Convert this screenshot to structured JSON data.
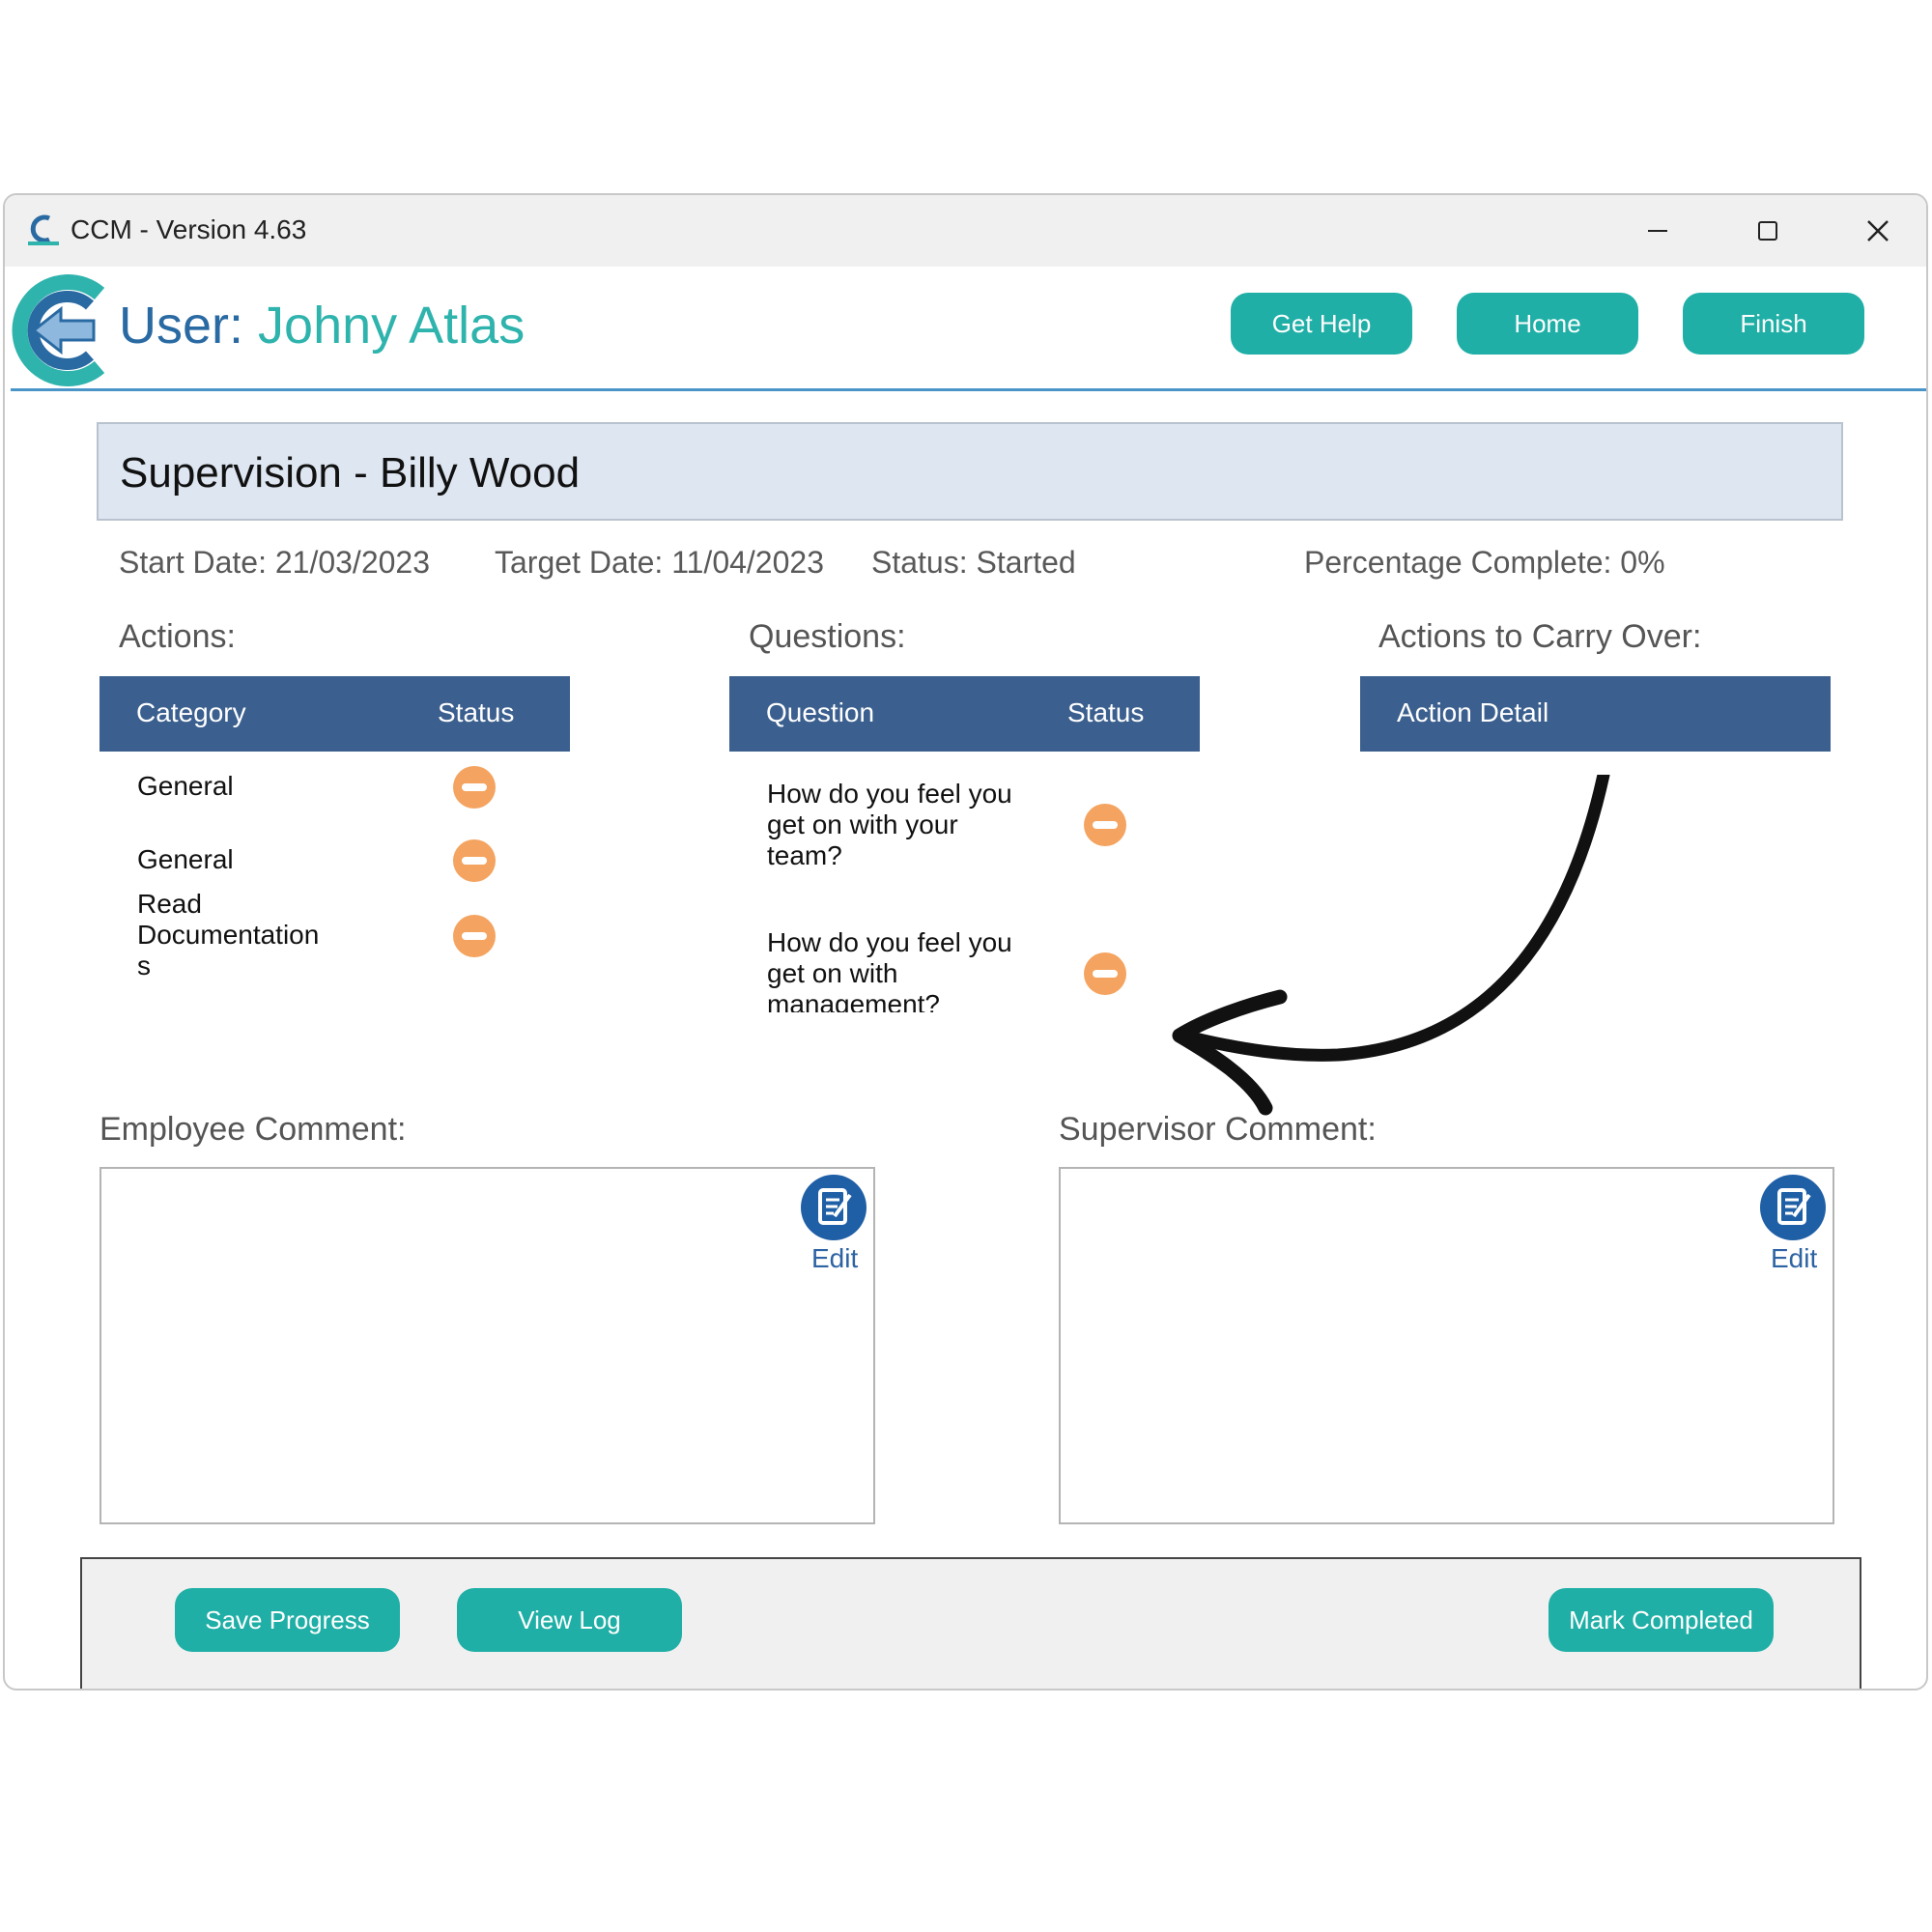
{
  "window": {
    "title": "CCM - Version 4.63",
    "controls": [
      "minimize-icon",
      "maximize-icon",
      "close-icon"
    ]
  },
  "header": {
    "user_label": "User:",
    "user_name": "Johny Atlas",
    "buttons": {
      "help": "Get Help",
      "home": "Home",
      "finish": "Finish"
    }
  },
  "supervision": {
    "title": "Supervision - Billy Wood",
    "start_date": "Start Date: 21/03/2023",
    "target_date": "Target Date: 11/04/2023",
    "status": "Status: Started",
    "percentage": "Percentage Complete: 0%"
  },
  "actions": {
    "label": "Actions:",
    "columns": [
      "Category",
      "Status"
    ],
    "rows": [
      {
        "category": "General",
        "status_icon": "minus-circle-icon"
      },
      {
        "category": "General",
        "status_icon": "minus-circle-icon"
      },
      {
        "category_lines": [
          "Read",
          "Documentation",
          "s"
        ],
        "status_icon": "minus-circle-icon"
      }
    ]
  },
  "questions": {
    "label": "Questions:",
    "columns": [
      "Question",
      "Status"
    ],
    "rows": [
      {
        "lines": [
          "How do you feel you",
          "get on with your",
          "team?"
        ],
        "status_icon": "minus-circle-icon"
      },
      {
        "lines": [
          "How do you feel you",
          "get on with",
          "management?"
        ],
        "status_icon": "minus-circle-icon"
      }
    ]
  },
  "carry_over": {
    "label": "Actions to Carry Over:",
    "columns": [
      "Action Detail"
    ]
  },
  "comments": {
    "employee_label": "Employee Comment:",
    "supervisor_label": "Supervisor Comment:",
    "edit_label": "Edit"
  },
  "footer": {
    "save": "Save Progress",
    "view_log": "View Log",
    "mark_completed": "Mark Completed"
  },
  "colors": {
    "accent_teal": "#1fafa6",
    "table_header": "#3b5f8e",
    "title_box": "#dde6f1",
    "status_orange": "#f4a460",
    "edit_blue": "#1f5fa6"
  }
}
